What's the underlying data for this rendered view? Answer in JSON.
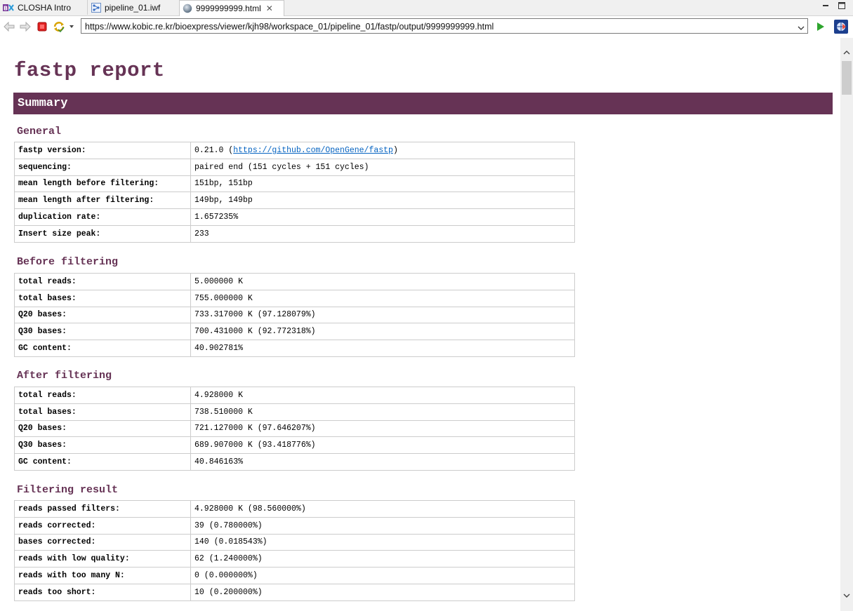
{
  "tabs": [
    {
      "label": "CLOSHA Intro"
    },
    {
      "label": "pipeline_01.iwf"
    },
    {
      "label": "9999999999.html"
    }
  ],
  "window": {
    "minimize": "☐",
    "maximize": "☐"
  },
  "url": "https://www.kobic.re.kr/bioexpress/viewer/kjh98/workspace_01/pipeline_01/fastp/output/9999999999.html",
  "colors": {
    "accent": "#663355",
    "link": "#0563c1"
  },
  "report": {
    "title": "fastp report",
    "summary_heading": "Summary",
    "general": {
      "heading": "General",
      "version_label": "fastp version:",
      "version_pre": "0.21.0 (",
      "version_link": "https://github.com/OpenGene/fastp",
      "version_post": ")",
      "rows": [
        {
          "k": "sequencing:",
          "v": "paired end (151 cycles + 151 cycles)"
        },
        {
          "k": "mean length before filtering:",
          "v": "151bp, 151bp"
        },
        {
          "k": "mean length after filtering:",
          "v": "149bp, 149bp"
        },
        {
          "k": "duplication rate:",
          "v": "1.657235%"
        },
        {
          "k": "Insert size peak:",
          "v": "233"
        }
      ]
    },
    "before": {
      "heading": "Before filtering",
      "rows": [
        {
          "k": "total reads:",
          "v": "5.000000 K"
        },
        {
          "k": "total bases:",
          "v": "755.000000 K"
        },
        {
          "k": "Q20 bases:",
          "v": "733.317000 K (97.128079%)"
        },
        {
          "k": "Q30 bases:",
          "v": "700.431000 K (92.772318%)"
        },
        {
          "k": "GC content:",
          "v": "40.902781%"
        }
      ]
    },
    "after": {
      "heading": "After filtering",
      "rows": [
        {
          "k": "total reads:",
          "v": "4.928000 K"
        },
        {
          "k": "total bases:",
          "v": "738.510000 K"
        },
        {
          "k": "Q20 bases:",
          "v": "721.127000 K (97.646207%)"
        },
        {
          "k": "Q30 bases:",
          "v": "689.907000 K (93.418776%)"
        },
        {
          "k": "GC content:",
          "v": "40.846163%"
        }
      ]
    },
    "filtering": {
      "heading": "Filtering result",
      "rows": [
        {
          "k": "reads passed filters:",
          "v": "4.928000 K (98.560000%)"
        },
        {
          "k": "reads corrected:",
          "v": "39 (0.780000%)"
        },
        {
          "k": "bases corrected:",
          "v": "140 (0.018543%)"
        },
        {
          "k": "reads with low quality:",
          "v": "62 (1.240000%)"
        },
        {
          "k": "reads with too many N:",
          "v": "0 (0.000000%)"
        },
        {
          "k": "reads too short:",
          "v": "10 (0.200000%)"
        }
      ]
    }
  }
}
